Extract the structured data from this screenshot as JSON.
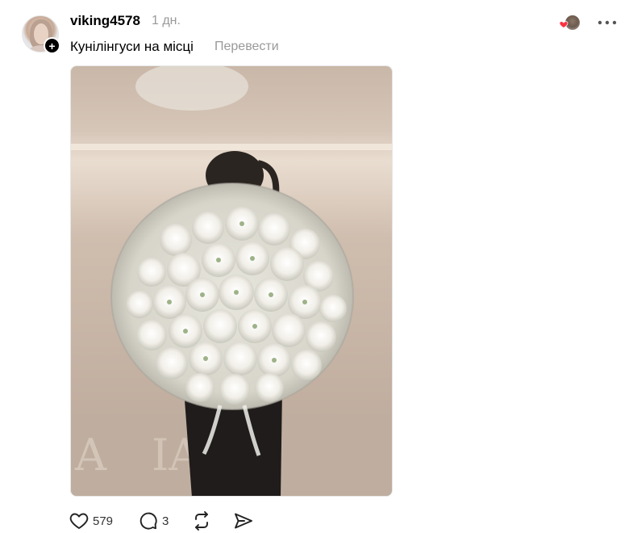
{
  "post": {
    "username": "viking4578",
    "timestamp": "1 дн.",
    "caption": "Кунілінгуси на місці",
    "translate_label": "Перевести",
    "follow_badge_icon": "plus-icon",
    "more_icon": "more-horizontal-icon",
    "liked_by_icon": "heart-icon",
    "image_description_icon": "photo"
  },
  "actions": {
    "like_count": "579",
    "reply_count": "3",
    "like_icon": "heart-outline-icon",
    "reply_icon": "speech-bubble-icon",
    "repost_icon": "repost-icon",
    "share_icon": "send-icon"
  },
  "colors": {
    "text": "#000000",
    "muted": "#999999",
    "heart_red": "#ff3040",
    "photo_wall": "#cbb9aa",
    "photo_floor": "#b8a79a"
  }
}
